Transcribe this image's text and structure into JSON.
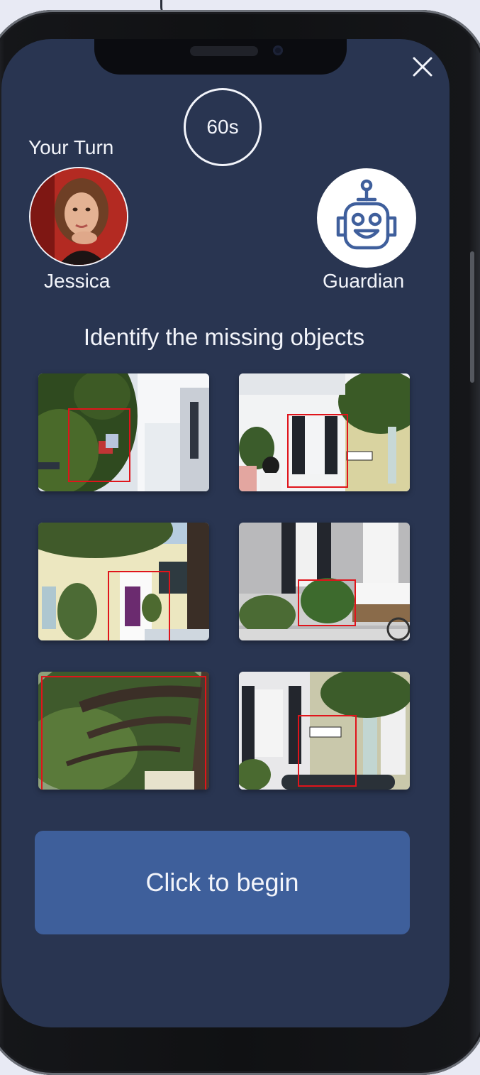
{
  "header": {
    "timer": "60s",
    "turn_label": "Your Turn",
    "close_icon": "close-icon"
  },
  "players": {
    "player": {
      "name": "Jessica",
      "avatar": "user-photo"
    },
    "opponent": {
      "name": "Guardian",
      "avatar": "robot-icon"
    }
  },
  "prompt": "Identify the missing objects",
  "tiles": [
    {
      "scene": "magnolia tree with flag",
      "marker": "flag"
    },
    {
      "scene": "house facade with shutters",
      "marker": "window"
    },
    {
      "scene": "yellow house with purple door",
      "marker": "door"
    },
    {
      "scene": "white house with bushes",
      "marker": "bush"
    },
    {
      "scene": "oak tree branches",
      "marker": "tree"
    },
    {
      "scene": "street with one-way sign",
      "marker": "sign"
    }
  ],
  "cta": {
    "label": "Click to begin"
  },
  "colors": {
    "screen_bg": "#293551",
    "button_bg": "#3e5f9b",
    "marker": "#e0141b",
    "text": "#f2f4fa"
  }
}
